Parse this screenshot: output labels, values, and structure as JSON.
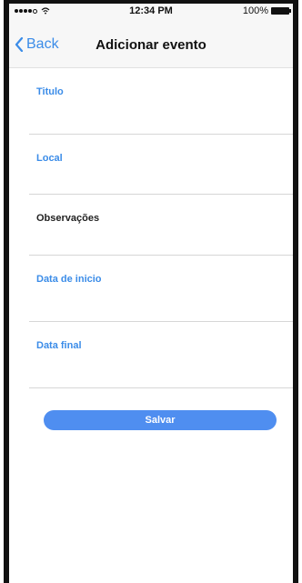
{
  "status_bar": {
    "time": "12:34 PM",
    "battery": "100%"
  },
  "nav": {
    "back_label": "Back",
    "title": "Adicionar evento"
  },
  "form": {
    "fields": [
      {
        "label": "Titulo",
        "value": ""
      },
      {
        "label": "Local",
        "value": ""
      },
      {
        "label": "Observações",
        "value": ""
      },
      {
        "label": "Data de inicio",
        "value": ""
      },
      {
        "label": "Data final",
        "value": ""
      }
    ],
    "save_label": "Salvar"
  },
  "colors": {
    "accent": "#3b8ce8",
    "button": "#4f8ef0"
  }
}
